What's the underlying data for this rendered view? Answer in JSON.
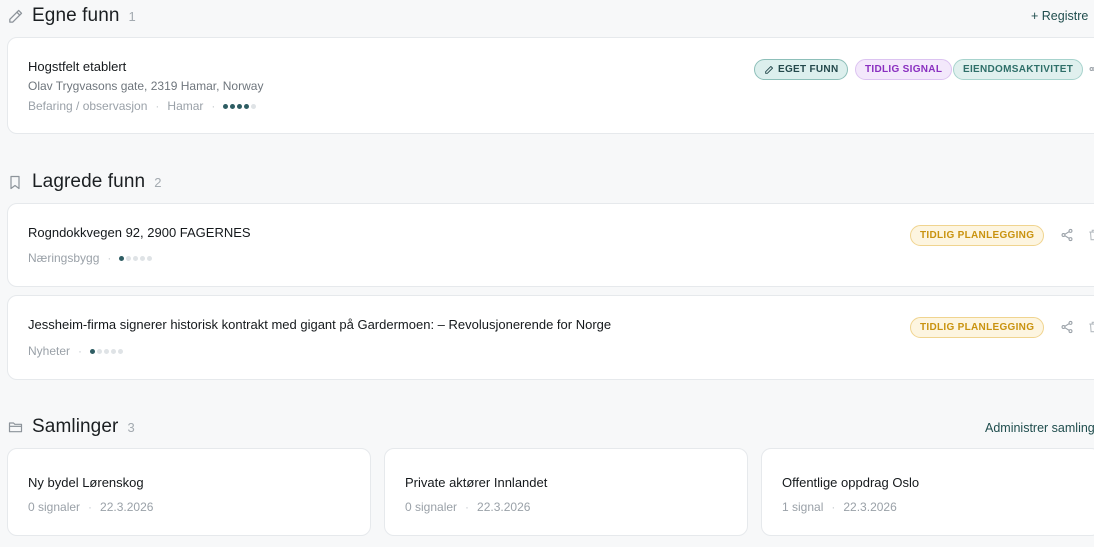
{
  "sections": {
    "own": {
      "title": "Egne funn",
      "count": "1",
      "action": "+ Registre",
      "icon": "pencil-icon"
    },
    "saved": {
      "title": "Lagrede funn",
      "count": "2",
      "icon": "bookmark-icon"
    },
    "collections": {
      "title": "Samlinger",
      "count": "3",
      "action": "Administrer samling",
      "icon": "folder-icon"
    }
  },
  "own_findings": [
    {
      "title": "Hogstfelt etablert",
      "address": "Olav Trygvasons gate, 2319 Hamar, Norway",
      "category": "Befaring / observasjon",
      "location": "Hamar",
      "strength": 0.8,
      "badges": [
        "EGET FUNN",
        "TIDLIG SIGNAL",
        "EIENDOMSAKTIVITET"
      ]
    }
  ],
  "saved_findings": [
    {
      "title": "Rogndokkvegen 92, 2900 FAGERNES",
      "category": "Næringsbygg",
      "strength": 0.2,
      "badge": "TIDLIG PLANLEGGING"
    },
    {
      "title": "Jessheim-firma signerer historisk kontrakt med gigant på Gardermoen: – Revolusjonerende for Norge",
      "category": "Nyheter",
      "strength": 0.2,
      "badge": "TIDLIG PLANLEGGING"
    }
  ],
  "collections": [
    {
      "title": "Ny bydel Lørenskog",
      "signals": "0 signaler",
      "date": "22.3.2026"
    },
    {
      "title": "Private aktører Innlandet",
      "signals": "0 signaler",
      "date": "22.3.2026"
    },
    {
      "title": "Offentlige oppdrag Oslo",
      "signals": "1 signal",
      "date": "22.3.2026"
    }
  ],
  "colors": {
    "accent": "#2e5d63",
    "background": "#f7f8f9",
    "plan_badge": "#c9930f",
    "early_badge": "#8a2fc0"
  }
}
